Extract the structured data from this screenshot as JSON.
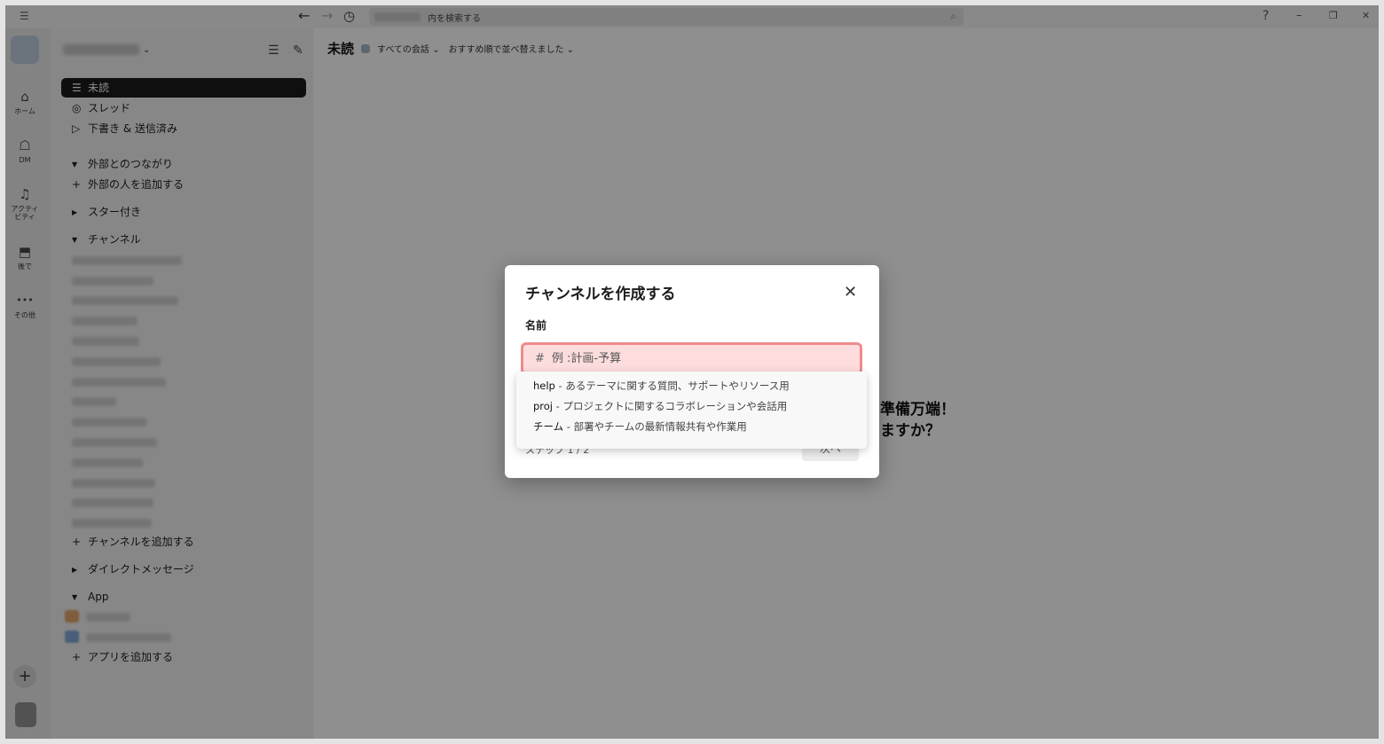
{
  "titlebar": {
    "search_text": "内を検索する",
    "help": "?",
    "minimize": "–",
    "restore": "❐",
    "close": "✕"
  },
  "rail": {
    "items": [
      {
        "label": "ホーム",
        "icon": "home-icon",
        "glyph": "⌂"
      },
      {
        "label": "DM",
        "icon": "dm-icon",
        "glyph": "☖"
      },
      {
        "label": "アクティビティ",
        "label_line1": "アクティ",
        "label_line2": "ビティ",
        "icon": "bell-icon",
        "glyph": "♫"
      },
      {
        "label": "後で",
        "icon": "bookmark-icon",
        "glyph": "⬒"
      },
      {
        "label": "その他",
        "icon": "more-icon",
        "glyph": "•••"
      }
    ],
    "add": "+"
  },
  "sidebar": {
    "nav": [
      {
        "label": "未読",
        "icon": "unreads-icon",
        "glyph": "☰",
        "active": true
      },
      {
        "label": "スレッド",
        "icon": "threads-icon",
        "glyph": "◎"
      },
      {
        "label": "下書き & 送信済み",
        "icon": "send-icon",
        "glyph": "▷"
      }
    ],
    "sections": {
      "external": "外部とのつながり",
      "add_external": "外部の人を追加する",
      "starred": "スター付き",
      "channels": "チャンネル",
      "add_channel": "チャンネルを追加する",
      "dms": "ダイレクトメッセージ",
      "app": "App",
      "add_app": "アプリを追加する"
    }
  },
  "main": {
    "title": "未読",
    "filter": "すべての会話 ⌄",
    "sort": "おすすめ順で並べ替えました ⌄",
    "empty_line1": "準備万端！",
    "empty_line2": "ますか？"
  },
  "modal": {
    "title": "チャンネルを作成する",
    "close": "✕",
    "name_label": "名前",
    "input_prefix": "#",
    "input_placeholder": "例 :計画-予算",
    "step": "ステップ 1 / 2",
    "next": "次へ"
  },
  "suggestions": [
    {
      "key": "help",
      "desc": " - あるテーマに関する質問、サポートやリソース用"
    },
    {
      "key": "proj",
      "desc": " - プロジェクトに関するコラボレーションや会話用"
    },
    {
      "key": "チーム",
      "desc": " - 部署やチームの最新情報共有や作業用"
    }
  ],
  "colors": {
    "input_bg": "#fcdcdc",
    "input_border": "#ef8b8b",
    "active_nav": "#1a1a1a"
  }
}
